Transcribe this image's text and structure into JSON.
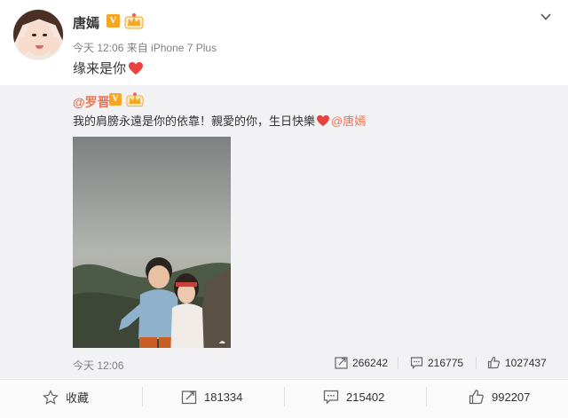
{
  "post": {
    "author": "唐嫣",
    "verified_badge": "V",
    "meta": "今天 12:06 来自 iPhone 7 Plus",
    "text": "缘来是你"
  },
  "repost": {
    "author": "@罗晋",
    "verified_badge": "V",
    "text": "我的肩膀永遠是你的依靠！親愛的你，生日快樂",
    "mention": "@唐嫣",
    "time": "今天 12:06",
    "stats": {
      "forwards": "266242",
      "comments": "216775",
      "likes": "1027437"
    }
  },
  "footer": {
    "favorite_label": "收藏",
    "forwards": "181334",
    "comments": "215402",
    "likes": "992207"
  },
  "colors": {
    "accent": "#eb7350",
    "badge": "#f5a623",
    "heart": "#e8423f"
  }
}
